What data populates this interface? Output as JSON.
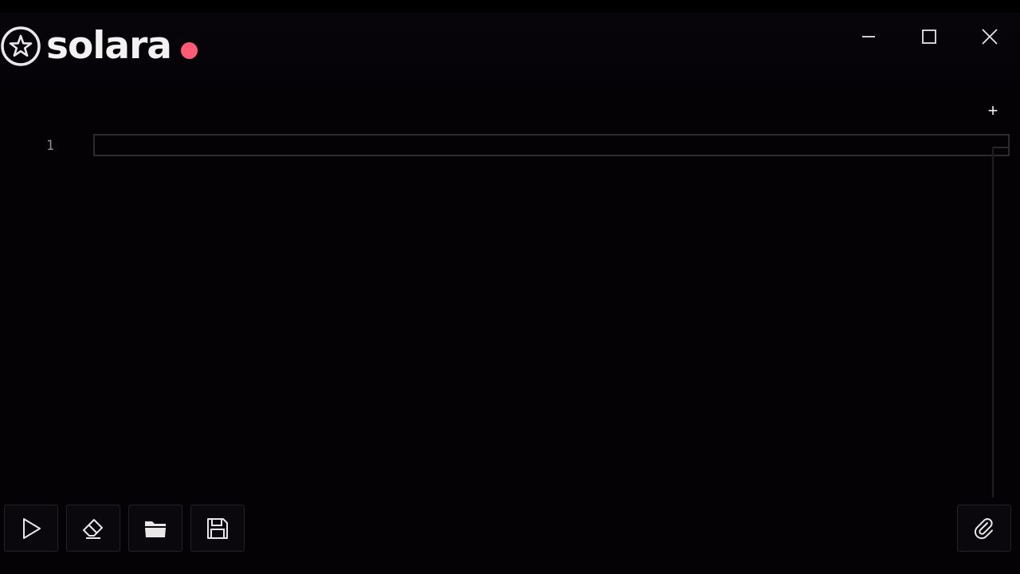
{
  "app": {
    "name": "solara",
    "status_color": "#ff5a76"
  },
  "window_controls": [
    {
      "name": "minimize-button",
      "icon": "minimize-icon"
    },
    {
      "name": "maximize-button",
      "icon": "maximize-icon"
    },
    {
      "name": "close-button",
      "icon": "close-icon"
    }
  ],
  "editor": {
    "add_tab_label": "+",
    "line_numbers": [
      "1"
    ],
    "lines": [
      ""
    ]
  },
  "toolbar": {
    "buttons": [
      {
        "name": "execute-button",
        "icon": "play-icon"
      },
      {
        "name": "clear-button",
        "icon": "eraser-icon"
      },
      {
        "name": "open-file-button",
        "icon": "folder-icon"
      },
      {
        "name": "save-file-button",
        "icon": "save-icon"
      },
      {
        "name": "attach-button",
        "icon": "paperclip-icon"
      }
    ]
  },
  "colors": {
    "background": "#040205",
    "text": "#f2f2f2",
    "accent": "#ff5a76"
  }
}
